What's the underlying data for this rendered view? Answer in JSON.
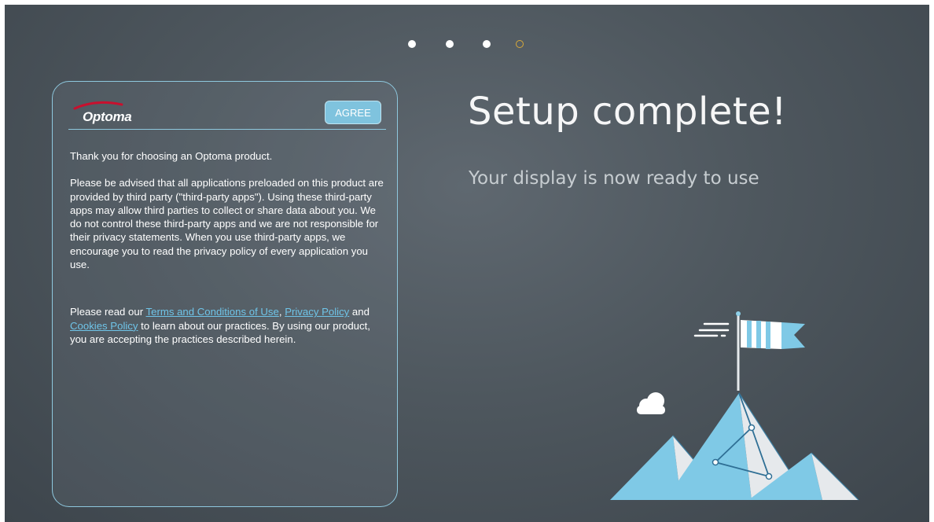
{
  "progress": {
    "total_steps": 4,
    "current_step": 4
  },
  "colors": {
    "accent": "#8ec8de",
    "button": "#7fc3de",
    "link": "#6fc4e8",
    "progress_current": "#d9a93a",
    "logo_red": "#c8102e"
  },
  "notice": {
    "logo_text": "Optoma",
    "agree_label": "AGREE",
    "thank_you": "Thank you for choosing an Optoma product.",
    "advisory": "Please be advised that all applications preloaded on this product are provided by third party (\"third-party apps\"). Using these third-party apps may allow third parties to collect or share data about you. We do not control these third-party apps and we are not responsible for their privacy statements. When you use third-party apps, we encourage you to read the privacy policy of every application you use.",
    "read_our": "Please read our ",
    "terms_link": "Terms and Conditions of Use",
    "comma": ", ",
    "privacy_link": "Privacy Policy",
    "and_text": " and ",
    "cookies_link": "Cookies Policy",
    "closing": " to learn about our practices. By using our product, you are accepting the practices described herein."
  },
  "setup": {
    "title": "Setup complete!",
    "subtitle": "Your display is now ready to use"
  },
  "illustration": {
    "icon": "mountain-flag-illustration"
  }
}
